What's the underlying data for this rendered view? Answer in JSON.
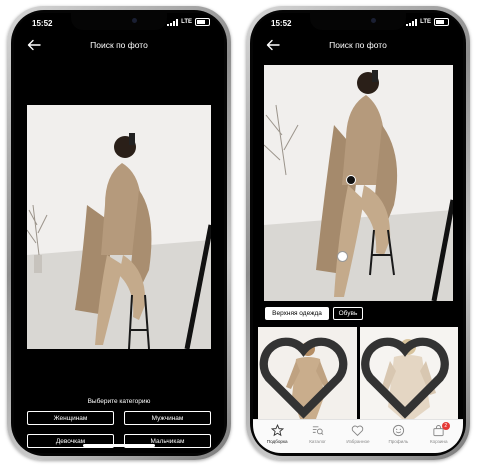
{
  "status_bar": {
    "time": "15:52",
    "network": "LTE"
  },
  "left_screen": {
    "header_title": "Поиск по фото",
    "category_prompt": "Выберите категорию",
    "categories": [
      "Женщинам",
      "Мужчинам",
      "Девочкам",
      "Мальчикам"
    ]
  },
  "right_screen": {
    "header_title": "Поиск по фото",
    "chips": [
      {
        "label": "Верхняя одежда",
        "selected": true
      },
      {
        "label": "Обувь",
        "selected": false
      }
    ],
    "tabs": [
      {
        "label": "Подборка",
        "icon": "star-icon",
        "active": true
      },
      {
        "label": "Каталог",
        "icon": "catalog-search-icon",
        "active": false
      },
      {
        "label": "Избранное",
        "icon": "heart-icon",
        "active": false
      },
      {
        "label": "Профиль",
        "icon": "smile-icon",
        "active": false
      },
      {
        "label": "Корзина",
        "icon": "bag-icon",
        "active": false,
        "badge": "2"
      }
    ]
  },
  "colors": {
    "accent_badge": "#e53935",
    "coat": "#b59a7c",
    "wall": "#f2f0ee",
    "floor": "#d8d6d2"
  }
}
